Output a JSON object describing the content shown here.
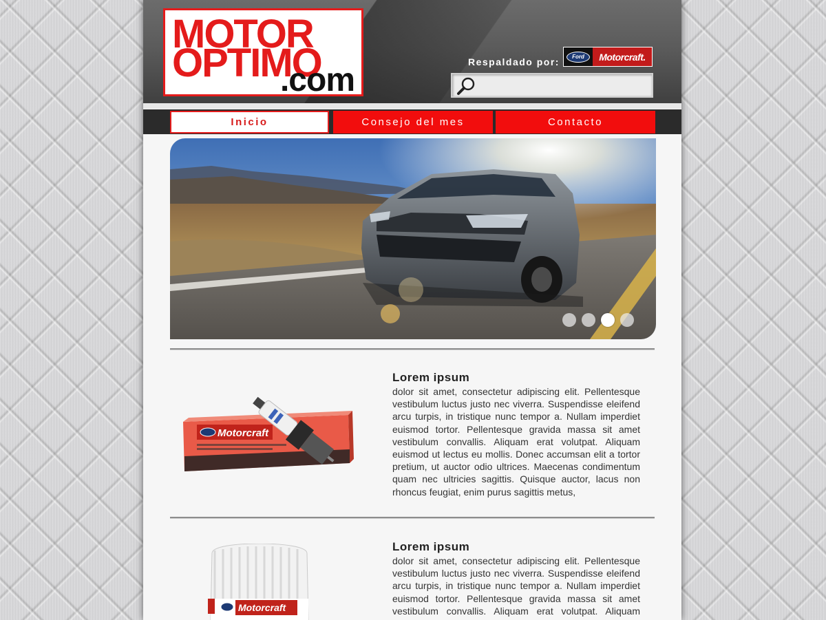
{
  "logo": {
    "line1": "MOTOR",
    "line2": "OPTIMO",
    "line3": ".com"
  },
  "header": {
    "backed_by": "Respaldado por:",
    "sponsor": {
      "ford": "Ford",
      "brand": "Motorcraft."
    }
  },
  "search": {
    "placeholder": "",
    "value": ""
  },
  "nav": {
    "tabs": [
      {
        "label": "Inicio",
        "active": true
      },
      {
        "label": "Consejo del mes",
        "active": false
      },
      {
        "label": "Contacto",
        "active": false
      }
    ]
  },
  "slider": {
    "slide_count": 4,
    "active_index": 2
  },
  "products": [
    {
      "title": "Lorem ipsum",
      "body": "dolor sit amet, consectetur adipiscing elit. Pellentesque vestibulum luctus justo nec viverra. Suspendisse eleifend arcu turpis, in tristique nunc tempor a. Nullam imperdiet euismod tortor. Pellentesque gravida massa sit amet vestibulum convallis. Aliquam erat volutpat. Aliquam euismod ut lectus eu mollis. Donec accumsan elit a tortor pretium, ut auctor odio ultrices. Maecenas condimentum quam nec ultricies sagittis. Quisque auctor, lacus non rhoncus feugiat, enim purus sagittis metus,",
      "image": {
        "brand": "Motorcraft",
        "ford": "Ford"
      }
    },
    {
      "title": "Lorem ipsum",
      "body": "dolor sit amet, consectetur adipiscing elit. Pellentesque vestibulum luctus justo nec viverra. Suspendisse eleifend arcu turpis, in tristique nunc tempor a. Nullam imperdiet euismod tortor. Pellentesque gravida massa sit amet vestibulum convallis. Aliquam erat volutpat. Aliquam euismod ut lectus eu mollis.",
      "image": {
        "brand": "Motorcraft",
        "ford": "Ford"
      }
    }
  ],
  "colors": {
    "brand_red": "#e41b1b",
    "nav_red": "#f20d0d",
    "header_gray": "#5b5b5b"
  }
}
